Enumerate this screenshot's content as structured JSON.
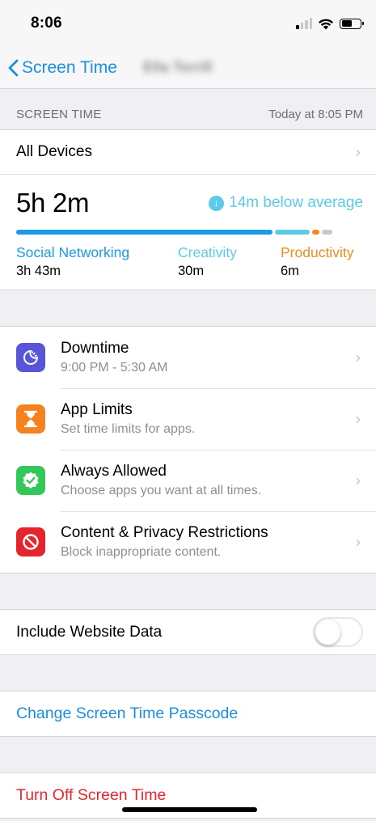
{
  "status": {
    "time": "8:06"
  },
  "nav": {
    "back_label": "Screen Time",
    "title": "Ella Terrill"
  },
  "screen_time": {
    "section_header": "Screen Time",
    "updated": "Today at 8:05 PM",
    "devices_label": "All Devices",
    "total": "5h 2m",
    "comparison": "14m below average",
    "bar_segments": [
      {
        "category": "Social Networking",
        "fraction": 0.74,
        "color": "#1a9ae6"
      },
      {
        "category": "Creativity",
        "fraction": 0.1,
        "color": "#5ccbe8"
      },
      {
        "category": "Productivity",
        "fraction": 0.02,
        "color": "#f08a1c"
      },
      {
        "category": "Other",
        "fraction": 0.03,
        "color": "#c7c7cc"
      }
    ],
    "categories": [
      {
        "name": "Social Networking",
        "time": "3h 43m",
        "color": "#1a9ae6"
      },
      {
        "name": "Creativity",
        "time": "30m",
        "color": "#5ccbe8"
      },
      {
        "name": "Productivity",
        "time": "6m",
        "color": "#f08a1c"
      }
    ]
  },
  "settings": [
    {
      "title": "Downtime",
      "subtitle": "9:00 PM - 5:30 AM",
      "icon": "downtime-icon",
      "color": "#5856d6"
    },
    {
      "title": "App Limits",
      "subtitle": "Set time limits for apps.",
      "icon": "hourglass-icon",
      "color": "#f5821f"
    },
    {
      "title": "Always Allowed",
      "subtitle": "Choose apps you want at all times.",
      "icon": "checkmark-badge-icon",
      "color": "#34c759"
    },
    {
      "title": "Content & Privacy Restrictions",
      "subtitle": "Block inappropriate content.",
      "icon": "restriction-icon",
      "color": "#e5252e"
    }
  ],
  "website_data": {
    "label": "Include Website Data",
    "enabled": false
  },
  "actions": {
    "change_passcode": "Change Screen Time Passcode",
    "turn_off": "Turn Off Screen Time"
  }
}
